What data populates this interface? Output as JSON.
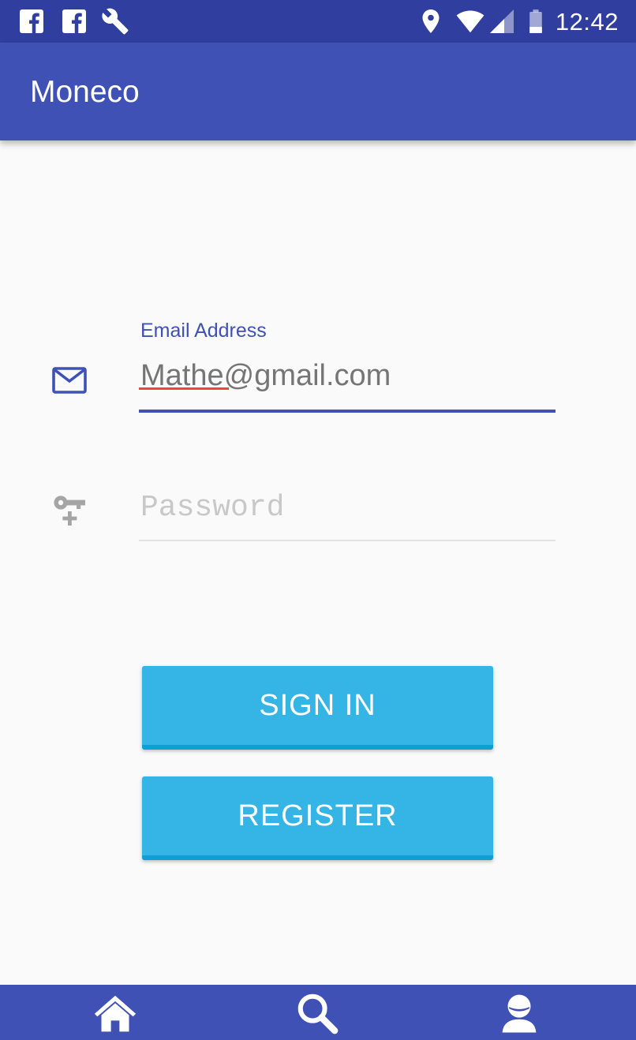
{
  "status_bar": {
    "time": "12:42",
    "left_icons": [
      "facebook-icon",
      "facebook-icon",
      "wrench-icon"
    ],
    "right_icons": [
      "location-icon",
      "wifi-icon",
      "cell-signal-icon",
      "battery-icon"
    ]
  },
  "app_bar": {
    "title": "Moneco"
  },
  "form": {
    "email": {
      "label": "Email Address",
      "value": "Mathe@gmail.com",
      "icon": "envelope-icon"
    },
    "password": {
      "placeholder": "Password",
      "icon": "key-add-icon"
    }
  },
  "buttons": {
    "sign_in": "SIGN IN",
    "register": "REGISTER"
  },
  "bottom_nav": {
    "items": [
      "home-icon",
      "search-icon",
      "profile-icon"
    ]
  },
  "colors": {
    "primary": "#3f51b5",
    "primary_dark": "#303f9f",
    "button": "#35b5e5",
    "button_shadow": "#0f9fd3",
    "spell_error": "#f44336"
  }
}
